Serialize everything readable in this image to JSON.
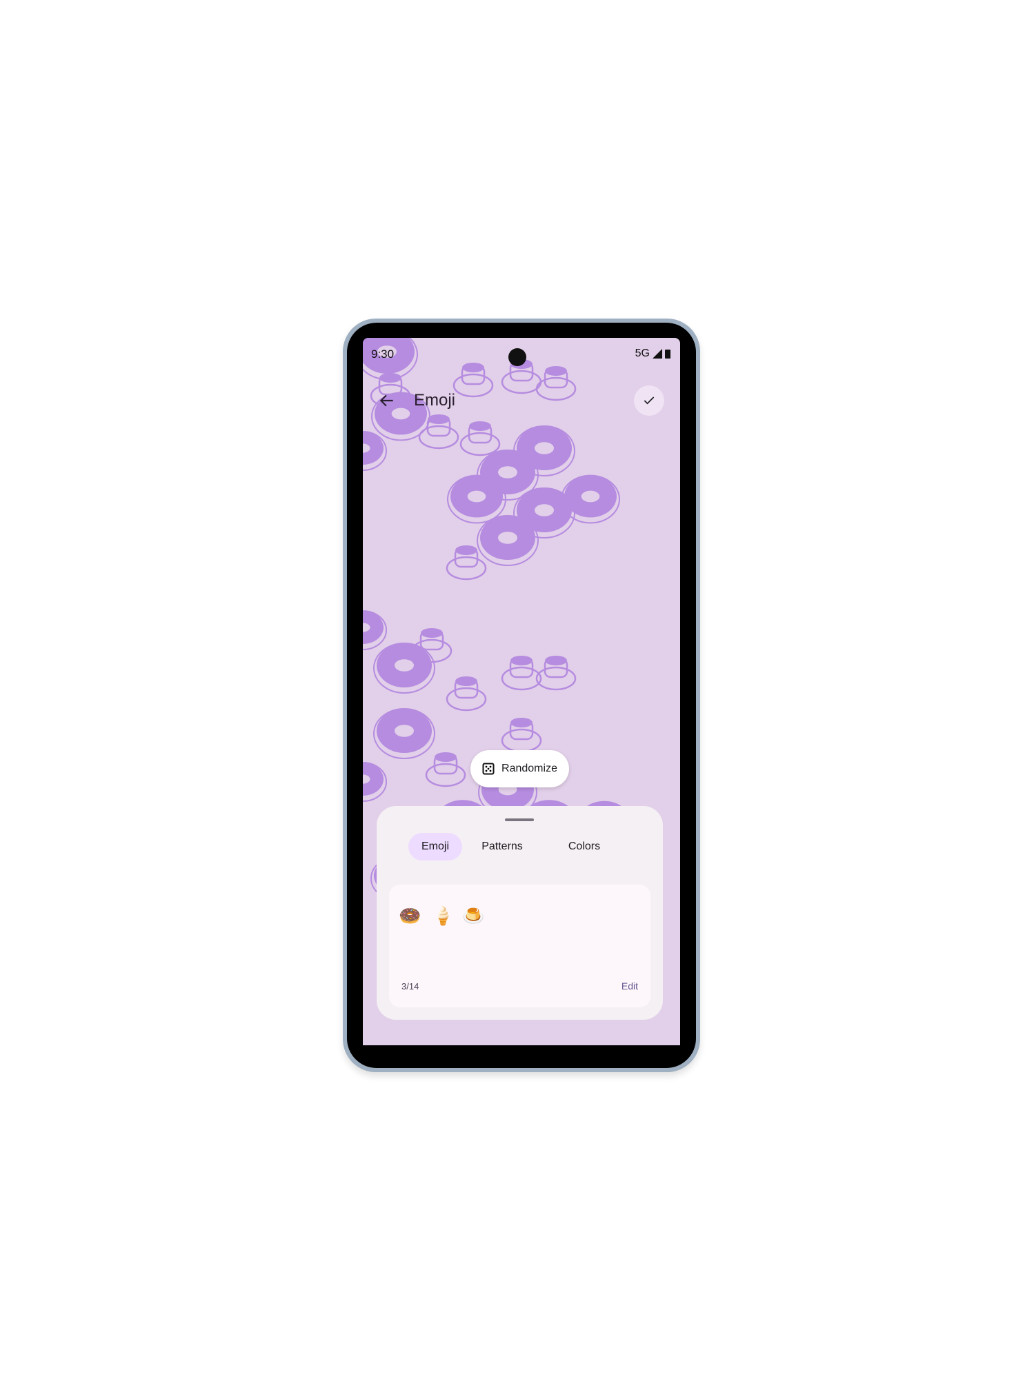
{
  "status_bar": {
    "time": "9:30",
    "network": "5G",
    "icons": [
      "signal-icon",
      "battery-icon"
    ]
  },
  "header": {
    "title": "Emoji",
    "back_icon": "arrow-left-icon",
    "confirm_icon": "check-icon"
  },
  "randomize": {
    "label": "Randomize",
    "icon": "dice-icon"
  },
  "sheet": {
    "tabs": [
      {
        "label": "Emoji",
        "active": true
      },
      {
        "label": "Patterns",
        "active": false
      },
      {
        "label": "Colors",
        "active": false
      }
    ],
    "emojis": [
      "🍩",
      "🍦",
      "🍮"
    ],
    "count": "3/14",
    "edit_label": "Edit"
  },
  "colors": {
    "background": "#e2cfe9",
    "pattern": "#b58ce0",
    "active_tab": "#eddcff"
  }
}
